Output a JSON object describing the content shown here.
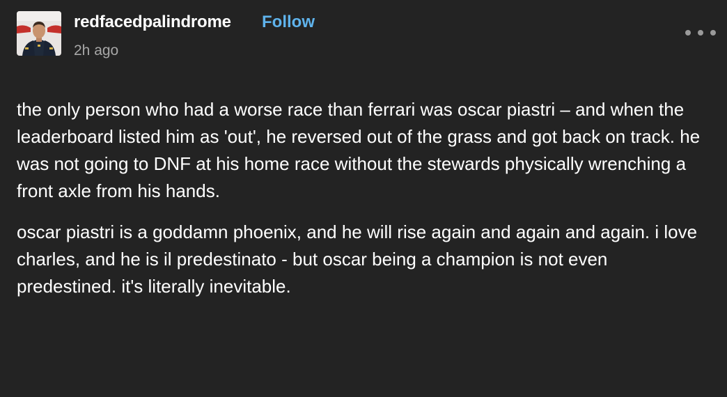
{
  "post": {
    "username": "redfacedpalindrome",
    "follow_label": "Follow",
    "timestamp": "2h ago",
    "more_icon": "ellipsis-icon",
    "paragraphs": [
      "the only person who had a worse race than ferrari was oscar piastri – and when the leaderboard listed him as 'out', he reversed out of the grass and got back on track. he was not going to DNF at his home race without the stewards physically wrenching a front axle from his hands.",
      "oscar piastri is a goddamn phoenix, and he will rise again and again and again. i love charles, and he is il predestinato - but oscar being a champion is not even predestined. it's literally inevitable."
    ]
  },
  "colors": {
    "background": "#232323",
    "text": "#ffffff",
    "follow": "#5fb3ec",
    "timestamp": "#a7a7a7"
  }
}
